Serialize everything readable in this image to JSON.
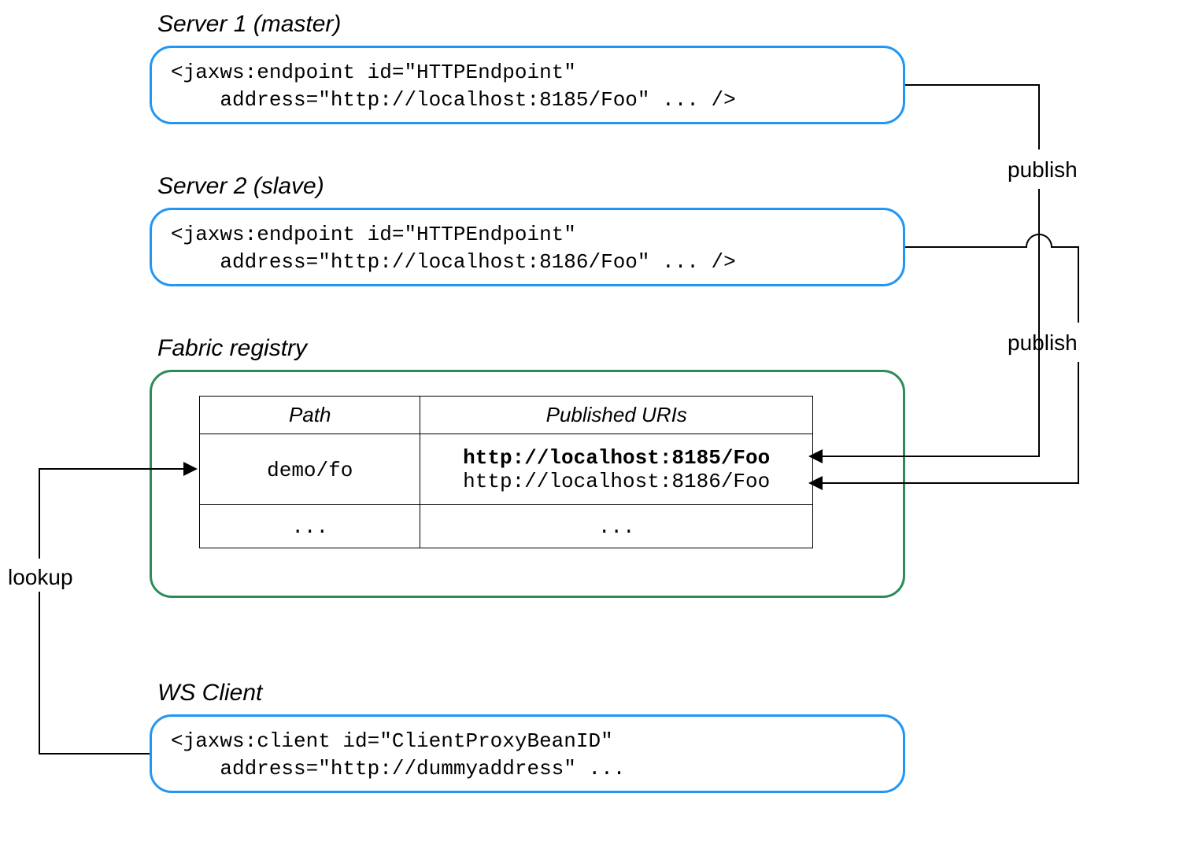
{
  "server1": {
    "title": "Server 1 (master)",
    "code": "<jaxws:endpoint id=\"HTTPEndpoint\"\n    address=\"http://localhost:8185/Foo\" ... />"
  },
  "server2": {
    "title": "Server 2 (slave)",
    "code": "<jaxws:endpoint id=\"HTTPEndpoint\"\n    address=\"http://localhost:8186/Foo\" ... />"
  },
  "registry": {
    "title": "Fabric registry",
    "headers": {
      "path": "Path",
      "uris": "Published URIs"
    },
    "row1": {
      "path": "demo/fo",
      "uri1": "http://localhost:8185/Foo",
      "uri2": "http://localhost:8186/Foo"
    },
    "row2": {
      "path": "...",
      "uris": "..."
    }
  },
  "client": {
    "title": "WS Client",
    "code": "<jaxws:client id=\"ClientProxyBeanID\"\n    address=\"http://dummyaddress\" ..."
  },
  "labels": {
    "publish": "publish",
    "lookup": "lookup"
  }
}
